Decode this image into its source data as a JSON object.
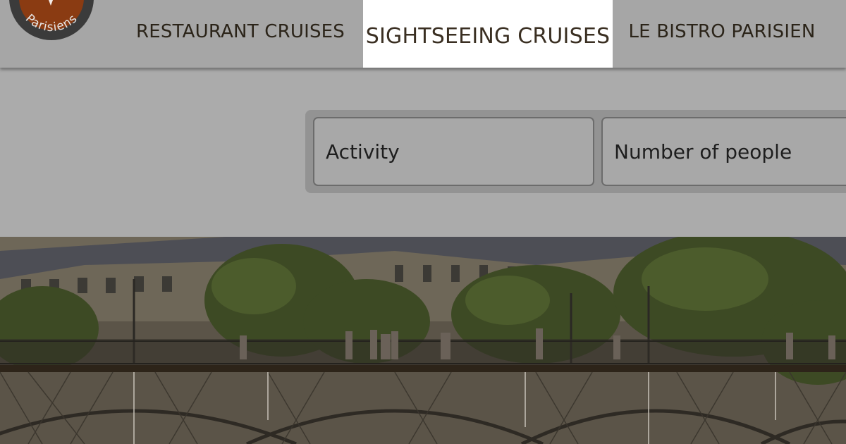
{
  "logo": {
    "text": "Parisiens",
    "brand_color": "#8a3b12",
    "ring_color": "#3b3b3b"
  },
  "nav": {
    "items": [
      {
        "label": "RESTAURANT CRUISES"
      },
      {
        "label": "SIGHTSEEING CRUISES",
        "active": true
      },
      {
        "label": "LE BISTRO PARISIEN"
      }
    ]
  },
  "search": {
    "activity_placeholder": "Activity",
    "people_placeholder": "Number of people"
  },
  "colors": {
    "overlay_gray": "#a9a9a9",
    "active_tab_bg": "#ffffff",
    "text_dark": "#2b2419"
  }
}
